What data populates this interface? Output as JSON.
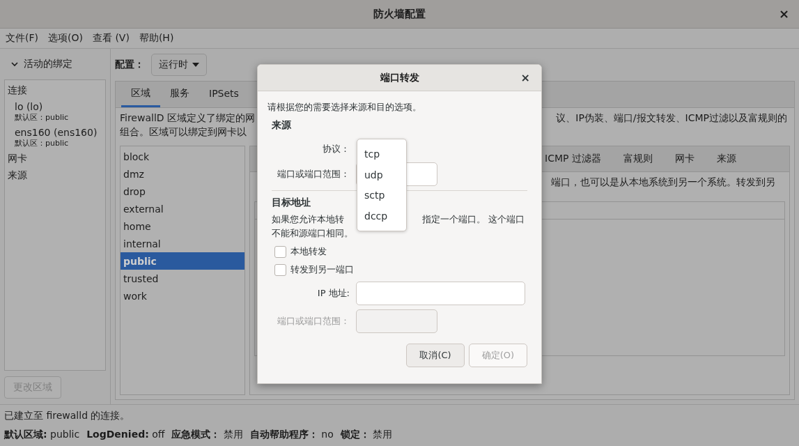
{
  "window": {
    "title": "防火墙配置",
    "close": "×"
  },
  "menu": [
    "文件(F)",
    "选项(O)",
    "查看 (V)",
    "帮助(H)"
  ],
  "sidebar": {
    "header": "活动的绑定",
    "expanded": true,
    "sections": [
      {
        "label": "连接",
        "children": [
          {
            "name": "lo (lo)",
            "detail": "默认区：public"
          },
          {
            "name": "ens160 (ens160)",
            "detail": "默认区：public"
          }
        ]
      },
      {
        "label": "网卡"
      },
      {
        "label": "来源"
      }
    ],
    "button": {
      "label": "更改区域",
      "disabled": true
    }
  },
  "config": {
    "label": "配置：",
    "value": "运行时"
  },
  "tabs": [
    {
      "label": "区域",
      "selected": true
    },
    {
      "label": "服务",
      "selected": false
    },
    {
      "label": "IPSets",
      "selected": false
    }
  ],
  "description": {
    "left": [
      "FirewallD 区域定义了绑定的网",
      "组合。区域可以绑定到网卡以"
    ],
    "right": "议、IP伪装、端口/报文转发、ICMP过滤以及富规则的"
  },
  "zones": [
    {
      "name": "block",
      "selected": false
    },
    {
      "name": "dmz",
      "selected": false
    },
    {
      "name": "drop",
      "selected": false
    },
    {
      "name": "external",
      "selected": false
    },
    {
      "name": "home",
      "selected": false
    },
    {
      "name": "internal",
      "selected": false
    },
    {
      "name": "public",
      "selected": true
    },
    {
      "name": "trusted",
      "selected": false
    },
    {
      "name": "work",
      "selected": false
    }
  ],
  "zone_tabs": [
    "ICMP 过滤器",
    "富规则",
    "网卡",
    "来源"
  ],
  "zone_description": "端口，也可以是从本地系统到另一个系统。转发到另",
  "status": {
    "message": "已建立至 firewalld 的连接。",
    "items": [
      {
        "label": "默认区域:",
        "value": "public"
      },
      {
        "label": "LogDenied:",
        "value": "off"
      },
      {
        "label": "应急模式：",
        "value": "禁用"
      },
      {
        "label": "自动帮助程序：",
        "value": "no"
      },
      {
        "label": "锁定：",
        "value": "禁用"
      }
    ]
  },
  "dialog": {
    "title": "端口转发",
    "close": "×",
    "intro": "请根据您的需要选择来源和目的选项。",
    "source_heading": "来源",
    "protocol_label": "协议：",
    "port_label": "端口或端口范围：",
    "dest_heading": "目标地址",
    "note_left": "如果您允许本地转",
    "note_right": "指定一个端口。 这个端口",
    "note_line2": "不能和源端口相同。",
    "checkboxes": [
      {
        "label": "本地转发",
        "checked": false
      },
      {
        "label": "转发到另一端口",
        "checked": false
      }
    ],
    "ip_label": "IP 地址:",
    "to_port": {
      "label": "端口或端口范围：",
      "disabled": true
    },
    "buttons": [
      {
        "label": "取消(C)",
        "disabled": false
      },
      {
        "label": "确定(O)",
        "disabled": true
      }
    ]
  },
  "protocol_menu": [
    "tcp",
    "udp",
    "sctp",
    "dccp"
  ]
}
